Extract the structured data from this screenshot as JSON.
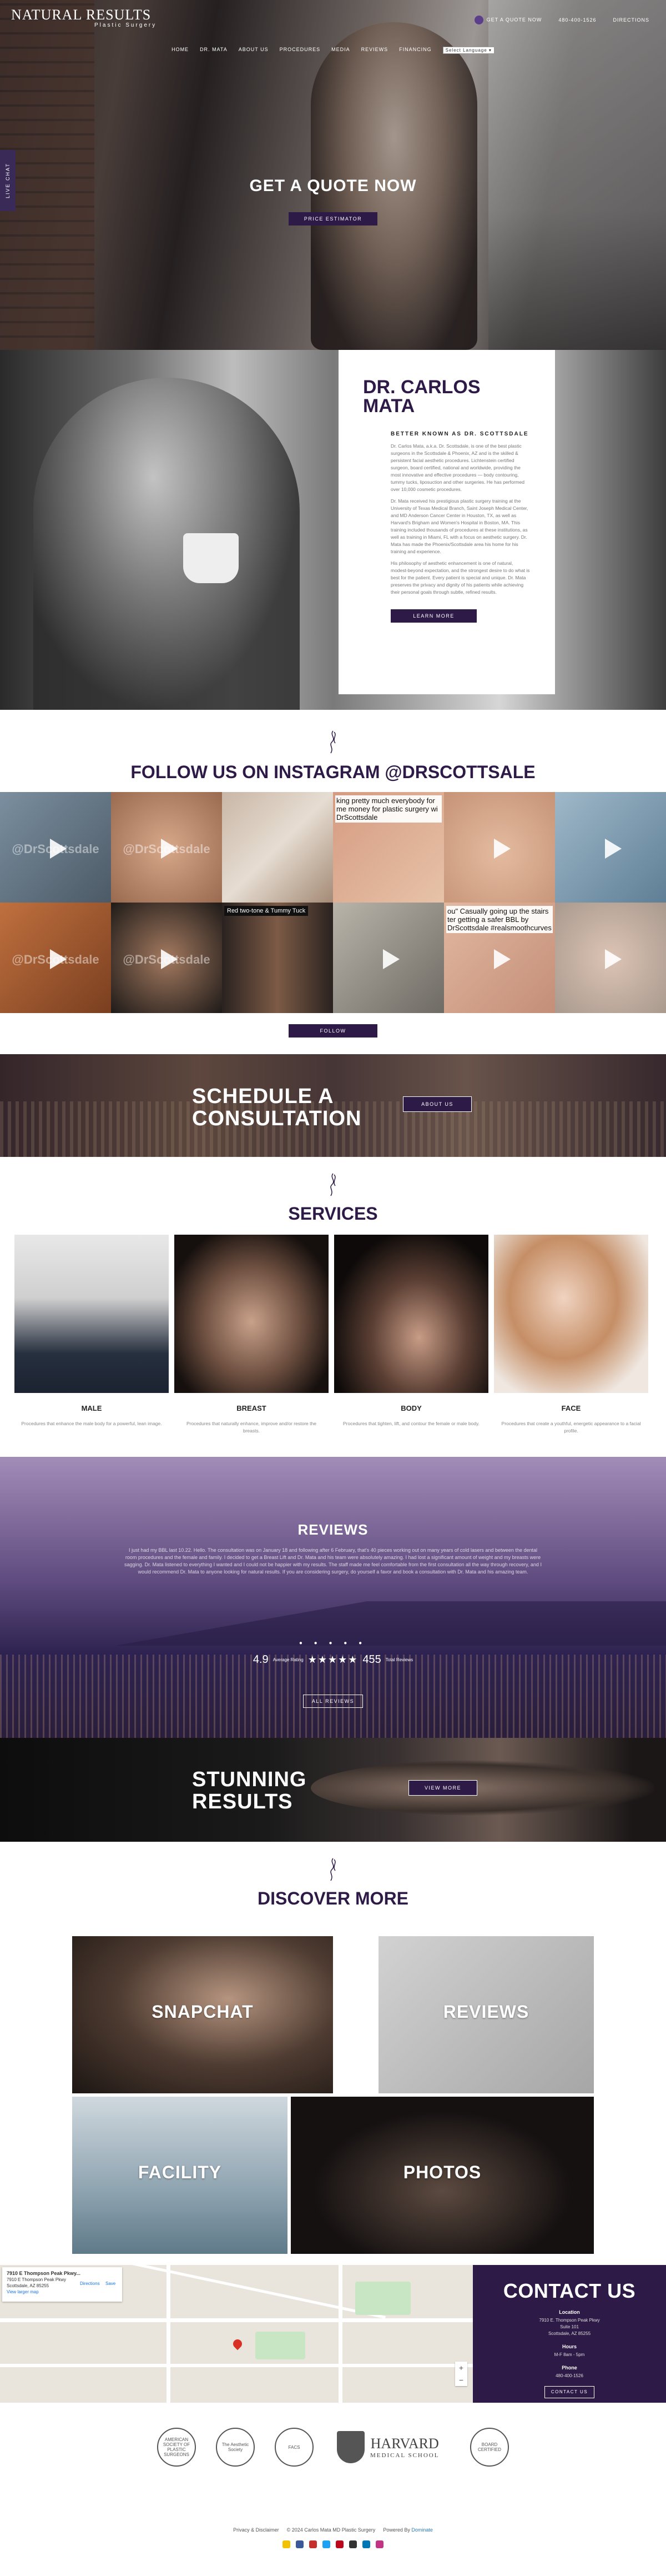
{
  "header": {
    "logo_text": "NATURAL RESULTS",
    "logo_sub": "Plastic Surgery",
    "quote_link": "GET A QUOTE NOW",
    "phone": "480-400-1526",
    "directions": "DIRECTIONS"
  },
  "nav": [
    "HOME",
    "DR. MATA",
    "ABOUT US",
    "PROCEDURES",
    "MEDIA",
    "REVIEWS",
    "FINANCING"
  ],
  "language_select": "Select Language",
  "side_tab": "LIVE CHAT",
  "hero": {
    "title": "GET A QUOTE NOW",
    "button": "PRICE ESTIMATOR"
  },
  "doctor": {
    "name_line1": "DR. CARLOS",
    "name_line2": "MATA",
    "subtitle": "BETTER KNOWN AS DR. SCOTTSDALE",
    "para1": "Dr. Carlos Mata, a.k.a. Dr. Scottsdale, is one of the best plastic surgeons in the Scottsdale & Phoenix, AZ and is the skilled & persistent facial aesthetic procedures. Lichtenstein certified surgeon, board certified, national and worldwide, providing the most innovative and effective procedures — body contouring, tummy tucks, liposuction and other surgeries. He has performed over 10,000 cosmetic procedures.",
    "para2": "Dr. Mata received his prestigious plastic surgery training at the University of Texas Medical Branch, Saint Joseph Medical Center, and MD Anderson Cancer Center in Houston, TX, as well as Harvard's Brigham and Women's Hospital in Boston, MA. This training included thousands of procedures at these institutions, as well as training in Miami, FL with a focus on aesthetic surgery. Dr. Mata has made the Phoenix/Scottsdale area his home for his training and experience.",
    "para3": "His philosophy of aesthetic enhancement is one of natural, modest-beyond expectation, and the strongest desire to do what is best for the patient. Every patient is special and unique. Dr. Mata preserves the privacy and dignity of his patients while achieving their personal goals through subtle, refined results.",
    "button": "LEARN MORE"
  },
  "instagram": {
    "title": "FOLLOW US ON INSTAGRAM @DRSCOTTSALE",
    "watermark": "@DrScottsdale",
    "caption1": "king pretty much everybody for\nme money for plastic surgery wi\nDrScottsdale",
    "caption2": "Red two-tone & Tummy Tuck",
    "caption3": "ou\" Casually going up the stairs\nter getting a safer BBL by\nDrScottsdale #realsmoothcurves",
    "button": "FOLLOW"
  },
  "schedule": {
    "line1": "SCHEDULE A",
    "line2": "CONSULTATION",
    "button": "ABOUT US"
  },
  "services": {
    "title": "SERVICES",
    "items": [
      {
        "name": "MALE",
        "desc": "Procedures that enhance the male body for a powerful, lean image."
      },
      {
        "name": "BREAST",
        "desc": "Procedures that naturally enhance, improve and/or restore the breasts."
      },
      {
        "name": "BODY",
        "desc": "Procedures that tighten, lift, and contour the female or male body."
      },
      {
        "name": "FACE",
        "desc": "Procedures that create a youthful, energetic appearance to a facial profile."
      }
    ]
  },
  "reviews": {
    "title": "REVIEWS",
    "quote": "I just had my BBL last 10.22. Hello. The consultation was on January 18 and following after 6 February, that's 40 pieces working out on many years of cold lasers and between the dental room procedures and the female and family. I decided to get a Breast Lift and Dr. Mata and his team were absolutely amazing. I had lost a significant amount of weight and my breasts were sagging. Dr. Mata listened to everything I wanted and I could not be happier with my results. The staff made me feel comfortable from the first consultation all the way through recovery, and I would recommend Dr. Mata to anyone looking for natural results. If you are considering surgery, do yourself a favor and book a consultation with Dr. Mata and his amazing team.",
    "dots": "● ● ● ● ●",
    "rating": "4.9",
    "rating_label": "Average Rating",
    "stars": "★★★★★",
    "total": "455",
    "total_label": "Total Reviews",
    "button": "ALL REVIEWS"
  },
  "stunning": {
    "line1": "STUNNING",
    "line2": "RESULTS",
    "button": "VIEW MORE"
  },
  "discover": {
    "title": "DISCOVER MORE",
    "tiles": [
      "SNAPCHAT",
      "REVIEWS",
      "FACILITY",
      "PHOTOS"
    ]
  },
  "map": {
    "place": "7910 E Thompson Peak Pkwy...",
    "address": "7910 E Thompson Peak Pkwy\nScottsdale, AZ 85255",
    "directions": "Directions",
    "larger": "View larger map",
    "save": "Save"
  },
  "contact": {
    "title": "CONTACT US",
    "location_label": "Location",
    "address": "7910 E. Thompson Peak Pkwy\nSuite 101\nScottsdale, AZ 85255",
    "hours_label": "Hours",
    "hours": "M-F 8am - 5pm",
    "phone_label": "Phone",
    "phone": "480-400-1526",
    "button": "CONTACT US"
  },
  "badges": [
    "AMERICAN SOCIETY OF PLASTIC SURGEONS",
    "The Aesthetic Society",
    "FACS",
    "HARVARD MEDICAL SCHOOL",
    "BOARD CERTIFIED"
  ],
  "harvard_text": "HARVARD",
  "harvard_sub": "MEDICAL SCHOOL",
  "footer": {
    "privacy": "Privacy & Disclaimer",
    "copyright": "© 2024 Carlos Mata MD Plastic Surgery",
    "powered": "Powered By",
    "agency": "Dominate"
  },
  "colors": {
    "primary": "#2e1a47",
    "text": "#333333"
  }
}
